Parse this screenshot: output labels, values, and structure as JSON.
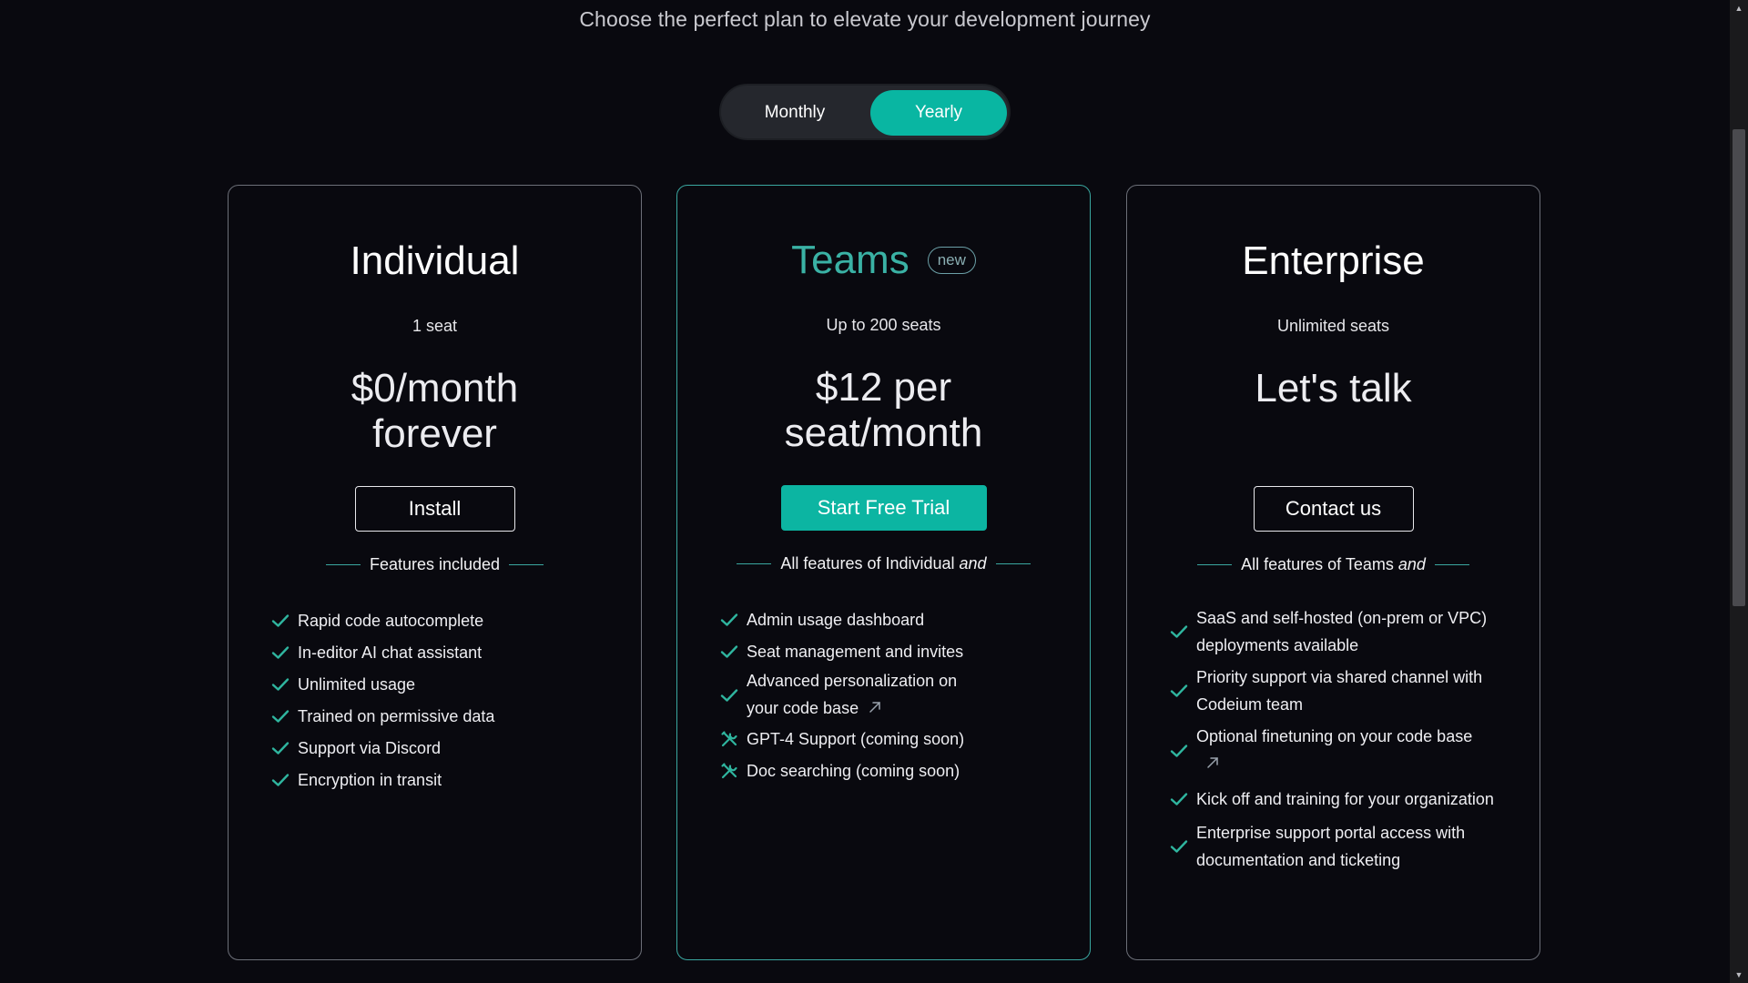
{
  "header": {
    "subtitle": "Choose the perfect plan to elevate your development journey"
  },
  "billing_toggle": {
    "options": [
      "Monthly",
      "Yearly"
    ],
    "selected": "Yearly",
    "accent": "#09b6a2"
  },
  "plans": [
    {
      "name": "Individual",
      "seats": "1 seat",
      "price_line1": "$0/month",
      "price_line2": "forever",
      "cta": "Install",
      "features_heading": "Features included",
      "features_heading_em": "",
      "features": [
        {
          "text": "Rapid code autocomplete",
          "icon": "check-icon"
        },
        {
          "text": "In-editor AI chat assistant",
          "icon": "check-icon"
        },
        {
          "text": "Unlimited usage",
          "icon": "check-icon"
        },
        {
          "text": "Trained on permissive data",
          "icon": "check-icon"
        },
        {
          "text": "Support via Discord",
          "icon": "check-icon"
        },
        {
          "text": "Encryption in transit",
          "icon": "check-icon"
        }
      ]
    },
    {
      "name": "Teams",
      "badge": "new",
      "seats": "Up to 200 seats",
      "price_line1": "$12 per",
      "price_line2": "seat/month",
      "cta": "Start Free Trial",
      "features_heading": "All features of Individual",
      "features_heading_em": "and",
      "features": [
        {
          "text": "Admin usage dashboard",
          "icon": "check-icon"
        },
        {
          "text": "Seat management and invites",
          "icon": "check-icon"
        },
        {
          "text": "Advanced personalization on your code base",
          "icon": "check-icon",
          "external": true
        },
        {
          "text": "GPT-4 Support (coming soon)",
          "icon": "tools-icon"
        },
        {
          "text": "Doc searching (coming soon)",
          "icon": "tools-icon"
        }
      ]
    },
    {
      "name": "Enterprise",
      "seats": "Unlimited seats",
      "price_line1": "Let's talk",
      "price_line2": "",
      "cta": "Contact us",
      "features_heading": "All features of Teams",
      "features_heading_em": "and",
      "features": [
        {
          "text": "SaaS and self-hosted (on-prem or VPC) deployments available",
          "icon": "check-icon"
        },
        {
          "text": "Priority support via shared channel with Codeium team",
          "icon": "check-icon"
        },
        {
          "text": "Optional finetuning on your code base",
          "icon": "check-icon",
          "external": true
        },
        {
          "text": "Kick off and training for your organization",
          "icon": "check-icon"
        },
        {
          "text": "Enterprise support portal access with documentation and ticketing",
          "icon": "check-icon"
        }
      ]
    }
  ],
  "colors": {
    "background": "#09090f",
    "accent": "#0cb5a2",
    "teams_title": "#3ab2a5",
    "card_border": "#6c6f78"
  }
}
